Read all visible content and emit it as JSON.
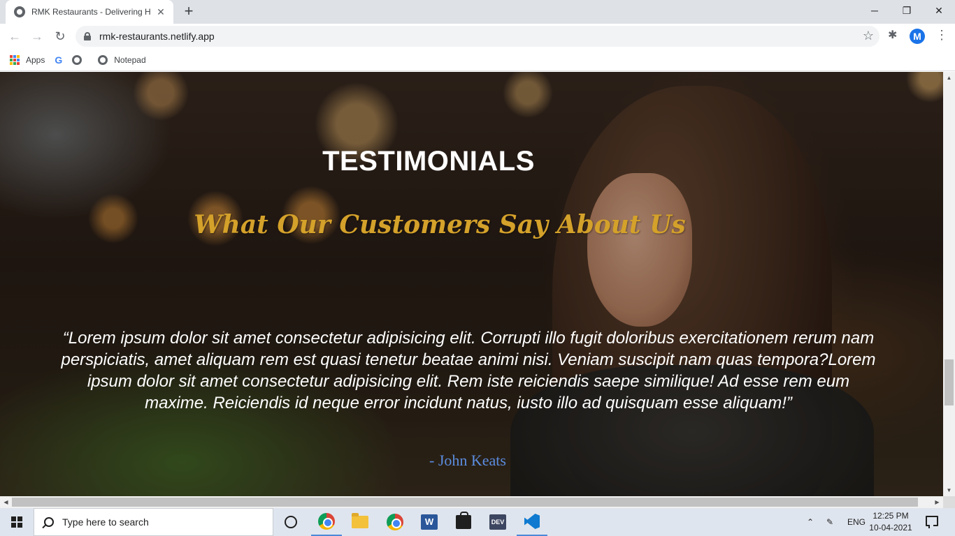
{
  "browser": {
    "tab_title": "RMK Restaurants - Delivering Happiness",
    "tab_close": "✕",
    "new_tab": "+",
    "url": "rmk-restaurants.netlify.app",
    "profile_initial": "M",
    "bookmarks": [
      {
        "label": "Apps",
        "icon": "apps-grid-icon"
      },
      {
        "label": "",
        "icon": "google-icon"
      },
      {
        "label": "",
        "icon": "globe-icon"
      },
      {
        "label": "Notepad",
        "icon": "globe-icon"
      }
    ],
    "window_controls": {
      "minimize": "─",
      "restore": "❐",
      "close": "✕"
    }
  },
  "page": {
    "section_title": "TESTIMONIALS",
    "section_subtitle": "What Our Customers Say About Us",
    "quote": "“Lorem ipsum dolor sit amet consectetur adipisicing elit. Corrupti illo fugit doloribus exercitationem rerum nam perspiciatis, amet aliquam rem est quasi tenetur beatae animi nisi. Veniam suscipit nam quas tempora?Lorem ipsum dolor sit amet consectetur adipisicing elit. Rem iste reiciendis saepe similique! Ad esse rem eum maxime. Reiciendis id neque error incidunt natus, iusto illo ad quisquam esse aliquam!”",
    "author": "- John Keats",
    "colors": {
      "subtitle": "#d4a12a",
      "author": "#5b8de0"
    }
  },
  "taskbar": {
    "search_placeholder": "Type here to search",
    "apps": [
      "chrome-profile",
      "file-explorer",
      "chrome",
      "word",
      "microsoft-store",
      "dev",
      "vscode"
    ],
    "tray": {
      "language": "ENG",
      "time": "12:25 PM",
      "date": "10-04-2021"
    }
  }
}
